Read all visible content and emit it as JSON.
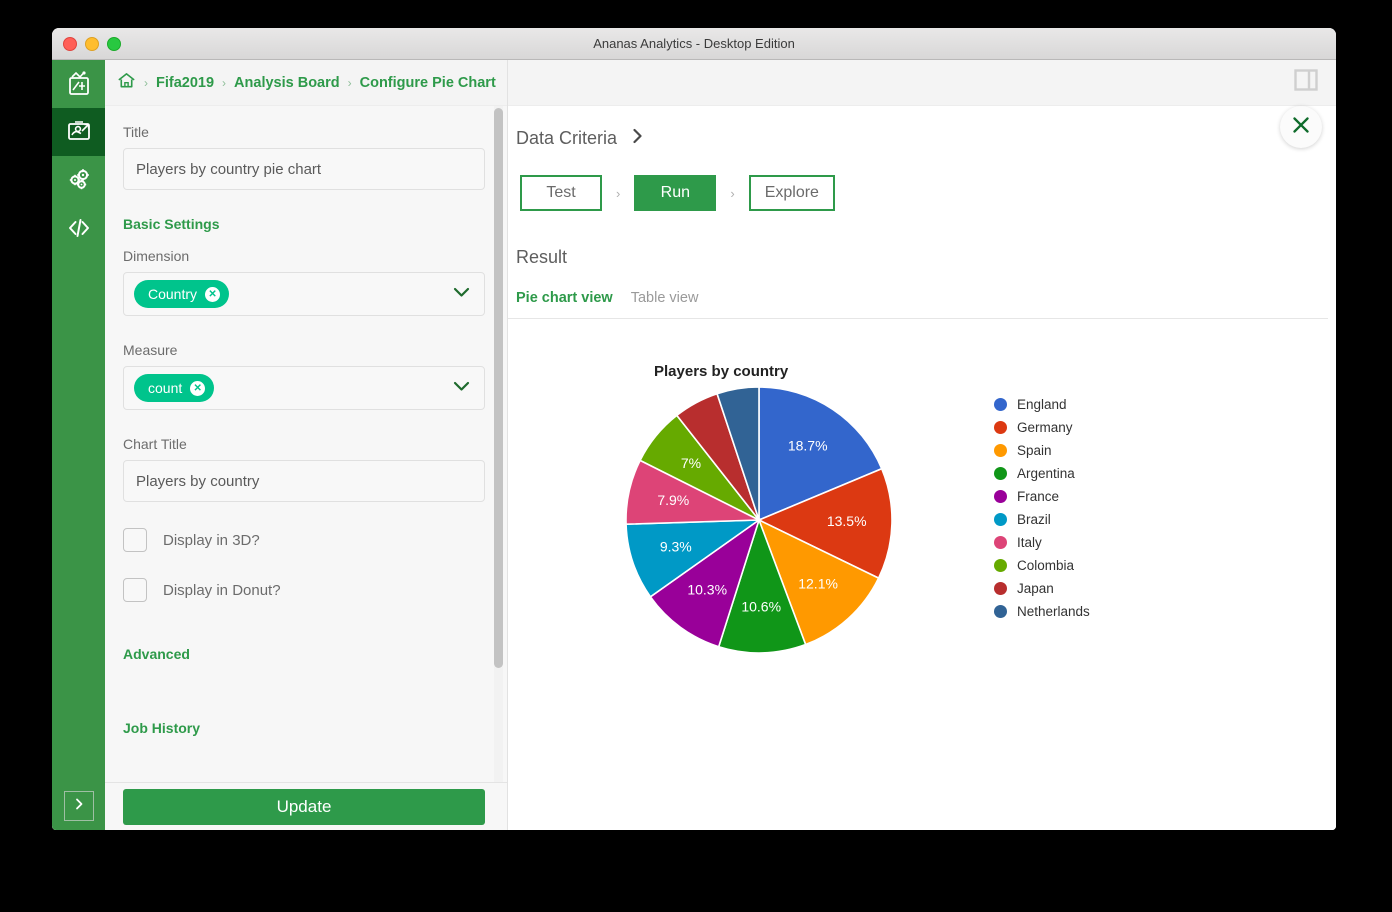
{
  "window": {
    "title": "Ananas Analytics - Desktop Edition",
    "traffic_lights": [
      "close",
      "minimize",
      "maximize"
    ]
  },
  "breadcrumb": {
    "home_icon": "home-icon",
    "items": [
      "Fifa2019",
      "Analysis Board",
      "Configure Pie Chart"
    ],
    "separator": "›"
  },
  "sidebar": {
    "items": [
      {
        "name": "data-source",
        "icon": "chart-board-icon",
        "active": false
      },
      {
        "name": "analysis-board",
        "icon": "presentation-hand-icon",
        "active": true
      },
      {
        "name": "settings",
        "icon": "gears-icon",
        "active": false
      },
      {
        "name": "code",
        "icon": "code-brackets-icon",
        "active": false
      }
    ],
    "expand_icon": "chevron-right-icon"
  },
  "config": {
    "title_label": "Title",
    "title_value": "Players by country pie chart",
    "title_placeholder": "Title",
    "basic_settings_heading": "Basic Settings",
    "dimension_label": "Dimension",
    "dimension_chip": "Country",
    "measure_label": "Measure",
    "measure_chip": "count",
    "chart_title_label": "Chart Title",
    "chart_title_value": "Players by country",
    "chart_title_placeholder": "Chart Title",
    "checkbox_3d": "Display in 3D?",
    "checkbox_3d_checked": false,
    "checkbox_donut": "Display in Donut?",
    "checkbox_donut_checked": false,
    "advanced_heading": "Advanced",
    "job_history_heading": "Job History",
    "update_button": "Update",
    "chip_remove_icon": "close-circle-icon",
    "dropdown_icon": "chevron-down-icon"
  },
  "result": {
    "criteria_title": "Data Criteria",
    "criteria_expand_icon": "chevron-right-icon",
    "steps": [
      {
        "label": "Test",
        "active": false
      },
      {
        "label": "Run",
        "active": true
      },
      {
        "label": "Explore",
        "active": false
      }
    ],
    "step_separator": "›",
    "result_label": "Result",
    "tabs": [
      {
        "label": "Pie chart view",
        "active": true
      },
      {
        "label": "Table view",
        "active": false
      }
    ],
    "close_icon": "close-icon",
    "panel_toggle_icon": "panel-layout-icon"
  },
  "colors": {
    "brand_green": "#2e9a4a",
    "rail_green": "#3b9447",
    "rail_active_green": "#0f5c21",
    "chip_teal": "#00c48c",
    "muted_text": "#6c6c6c"
  },
  "chart_data": {
    "type": "pie",
    "title": "Players by country",
    "legend_position": "right",
    "categories": [
      "England",
      "Germany",
      "Spain",
      "Argentina",
      "France",
      "Brazil",
      "Italy",
      "Colombia",
      "Japan",
      "Netherlands"
    ],
    "values": [
      18.7,
      13.5,
      12.1,
      10.6,
      10.3,
      9.3,
      7.9,
      7.0,
      5.5,
      5.1
    ],
    "labels": [
      "18.7%",
      "13.5%",
      "12.1%",
      "10.6%",
      "10.3%",
      "9.3%",
      "7.9%",
      "7%",
      "",
      ""
    ],
    "colors": [
      "#3366cc",
      "#dc3912",
      "#ff9900",
      "#109618",
      "#990099",
      "#0099c6",
      "#dd4477",
      "#66aa00",
      "#b82e2e",
      "#316395"
    ],
    "unit": "%",
    "start_angle": 0,
    "direction": "clockwise",
    "xlabel": "",
    "ylabel": ""
  }
}
